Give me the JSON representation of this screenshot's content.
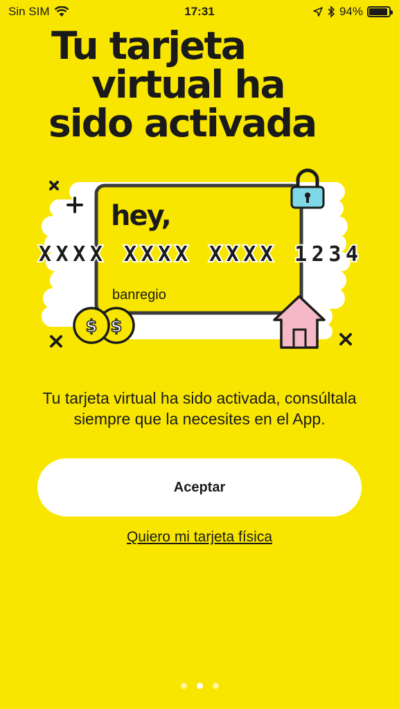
{
  "status_bar": {
    "carrier": "Sin SIM",
    "time": "17:31",
    "battery_percent": "94%",
    "battery_level": 0.94,
    "icons": [
      "wifi-icon",
      "location-arrow-icon",
      "bluetooth-icon",
      "battery-icon"
    ]
  },
  "headline": {
    "line1": "Tu tarjeta",
    "line2": "virtual ha",
    "line3": "sido activada"
  },
  "card": {
    "brand": "hey,",
    "number": "XXXX XXXX XXXX 1234",
    "bank": "banregio",
    "coin_symbol": "$"
  },
  "message": "Tu tarjeta virtual ha sido activada, consúltala siempre que la necesites en el App.",
  "accept_label": "Aceptar",
  "physical_card_link": "Quiero mi tarjeta física",
  "pagination": {
    "total": 3,
    "active": 2
  },
  "colors": {
    "background": "#f9e600",
    "lock": "#7fd8e6",
    "house": "#f5b8c6",
    "coin": "#f9e600",
    "text": "#1a1a1a"
  }
}
